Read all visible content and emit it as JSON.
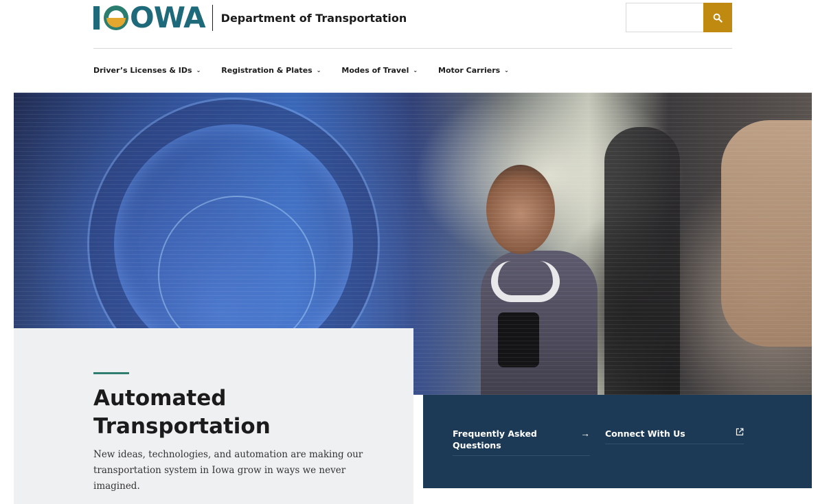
{
  "header": {
    "logo_letters": "OWA",
    "logo_alt": "IOWA",
    "department": "Department of Transportation",
    "search": {
      "placeholder": "",
      "value": "",
      "button_icon": "search-icon"
    },
    "accent_color": "#c08a10",
    "brand_color": "#1f6a7a"
  },
  "nav": {
    "items": [
      {
        "label": "Driver’s Licenses & IDs",
        "icon": "chevron-down-icon"
      },
      {
        "label": "Registration & Plates",
        "icon": "chevron-down-icon"
      },
      {
        "label": "Modes of Travel",
        "icon": "chevron-down-icon"
      },
      {
        "label": "Motor Carriers",
        "icon": "chevron-down-icon"
      }
    ]
  },
  "hero": {
    "card": {
      "title": "Automated Transportation",
      "description": "New ideas, technologies, and automation are making our transportation system in Iowa grow in ways we never imagined.",
      "accent_color": "#2f7d6f"
    },
    "panel": {
      "background": "#1c3a55",
      "links": [
        {
          "label": "Frequently Asked Questions",
          "icon": "arrow-right-icon"
        },
        {
          "label": "Connect With Us",
          "icon": "external-link-icon"
        }
      ]
    }
  }
}
